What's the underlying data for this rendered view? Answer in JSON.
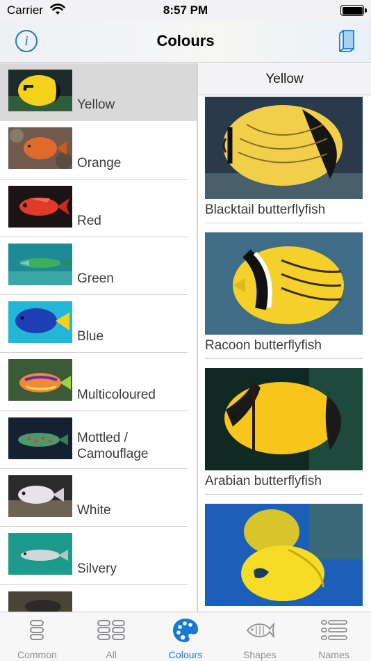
{
  "status_bar": {
    "carrier": "Carrier",
    "time": "8:57 PM"
  },
  "nav": {
    "title": "Colours",
    "left_icon": "info-icon",
    "right_icon": "book-icon"
  },
  "colours": [
    {
      "label": "Yellow",
      "selected": true
    },
    {
      "label": "Orange"
    },
    {
      "label": "Red"
    },
    {
      "label": "Green"
    },
    {
      "label": "Blue"
    },
    {
      "label": "Multicoloured"
    },
    {
      "label": "Mottled / Camouflage"
    },
    {
      "label": "White"
    },
    {
      "label": "Silvery"
    },
    {
      "label": ""
    }
  ],
  "detail": {
    "header": "Yellow",
    "fish": [
      {
        "name": "Blacktail butterflyfish"
      },
      {
        "name": "Racoon butterflyfish"
      },
      {
        "name": "Arabian butterflyfish"
      },
      {
        "name": ""
      }
    ]
  },
  "tabs": [
    {
      "label": "Common",
      "icon": "common-icon"
    },
    {
      "label": "All",
      "icon": "all-icon"
    },
    {
      "label": "Colours",
      "icon": "palette-icon",
      "active": true
    },
    {
      "label": "Shapes",
      "icon": "fish-shape-icon"
    },
    {
      "label": "Names",
      "icon": "names-list-icon"
    }
  ],
  "colors": {
    "accent": "#1a78d6",
    "selected_row": "#d9d9d9",
    "tab_inactive": "#8e8e93"
  }
}
